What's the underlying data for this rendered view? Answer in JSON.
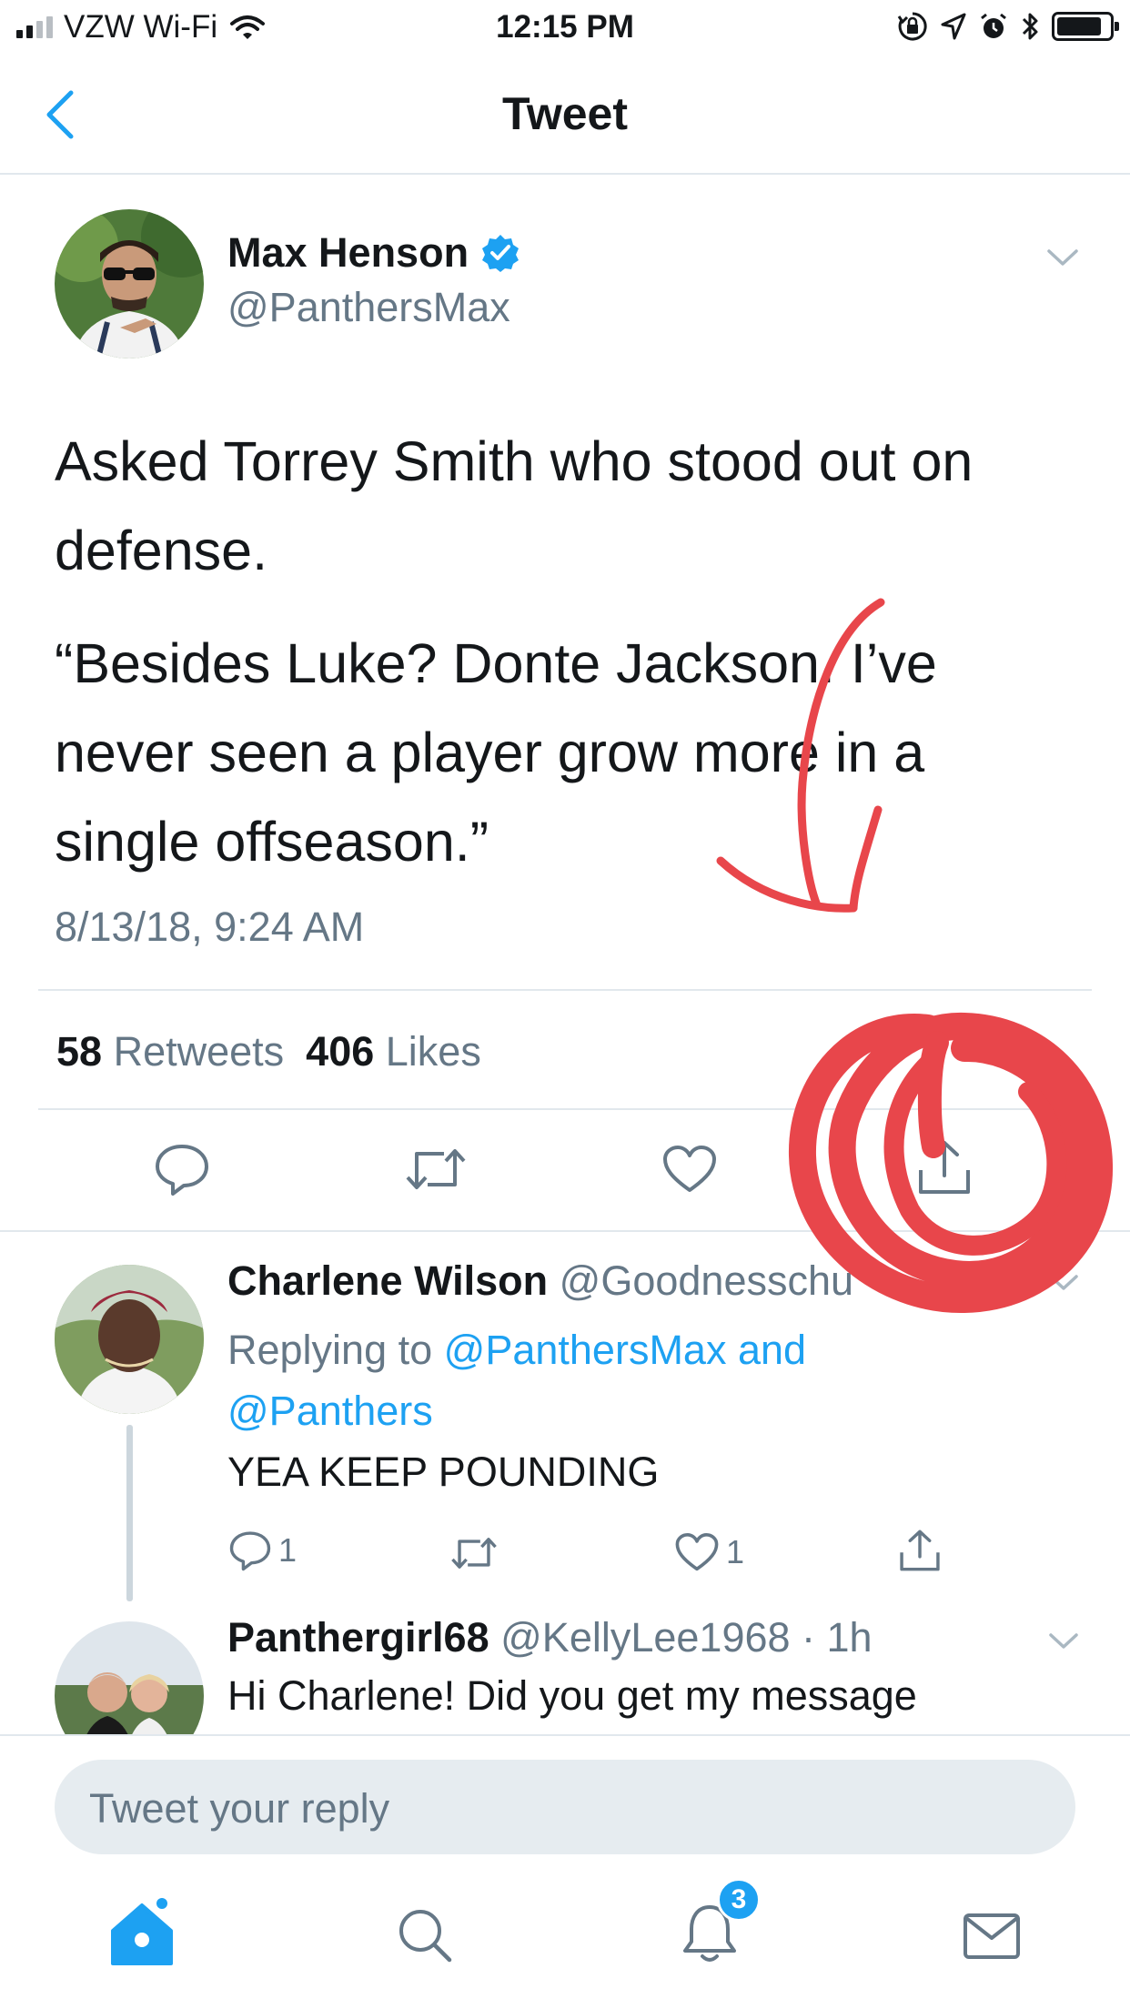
{
  "status_bar": {
    "carrier": "VZW Wi-Fi",
    "time": "12:15 PM",
    "battery_level": 0.85
  },
  "nav": {
    "title": "Tweet"
  },
  "tweet": {
    "author_name": "Max Henson",
    "author_handle": "@PanthersMax",
    "verified": true,
    "text_line1": "Asked Torrey Smith who stood out on",
    "text_line2": "defense.",
    "quote_line1": "“Besides Luke? Donte Jackson. I’ve",
    "quote_line2": "never seen a player grow more in a",
    "quote_line3": "single offseason.”",
    "timestamp": "8/13/18, 9:24 AM",
    "retweet_count": "58",
    "retweet_label": "Retweets",
    "like_count": "406",
    "like_label": "Likes"
  },
  "replies": [
    {
      "author_name": "Charlene Wilson",
      "author_handle": "@Goodnesschu",
      "replying_prefix": "Replying to",
      "replying_to_1": "@PanthersMax and",
      "replying_to_2": "@Panthers",
      "text": "YEA KEEP POUNDING",
      "reply_count": "1",
      "like_count": "1"
    },
    {
      "author_name": "Panthergirl68",
      "author_handle": "@KellyLee1968",
      "time": "· 1h",
      "text": "Hi Charlene! Did you get my message"
    }
  ],
  "composer": {
    "placeholder": "Tweet your reply"
  },
  "tab_bar": {
    "notifications_badge": "3"
  },
  "colors": {
    "accent": "#1da1f2",
    "text": "#14171a",
    "muted": "#657786",
    "divider": "#e1e8ed",
    "annotation": "#e8464b"
  },
  "icons": {
    "back": "chevron-left-icon",
    "verified": "verified-badge-icon",
    "caret": "chevron-down-icon",
    "reply": "reply-icon",
    "retweet": "retweet-icon",
    "like": "heart-icon",
    "share": "share-icon",
    "home": "home-icon",
    "search": "search-icon",
    "notifications": "bell-icon",
    "messages": "mail-icon"
  }
}
